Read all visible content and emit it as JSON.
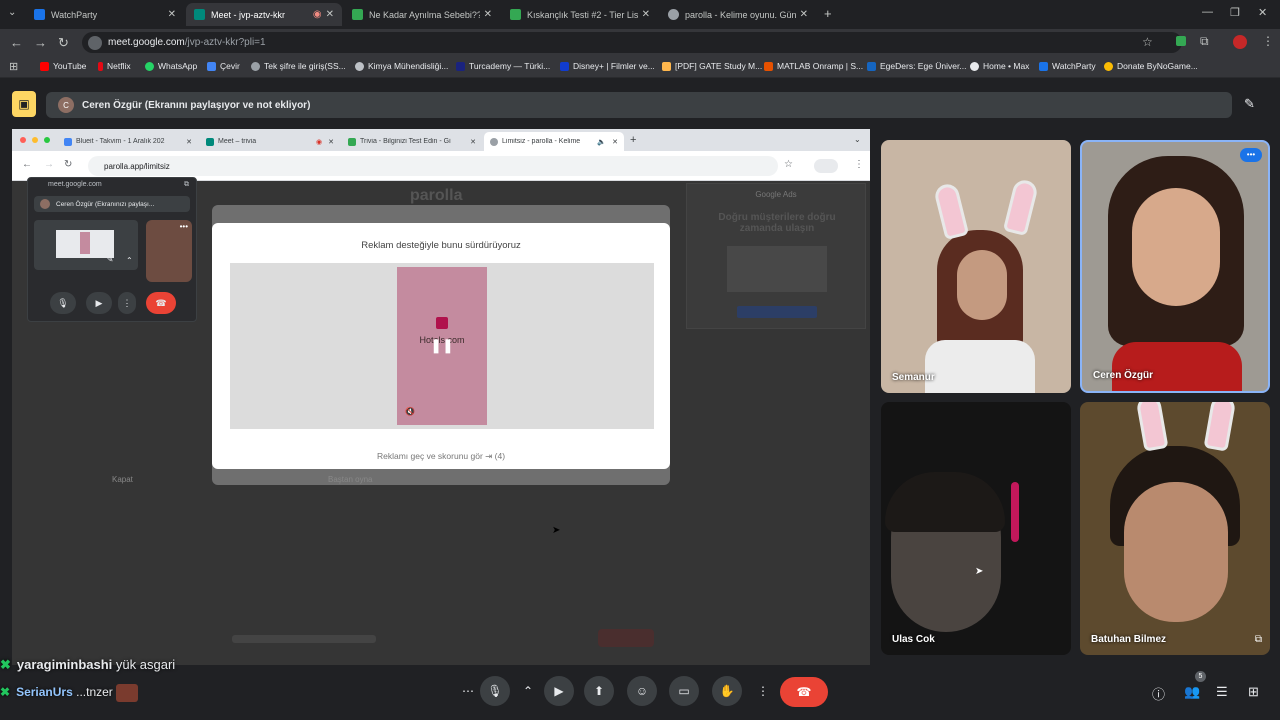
{
  "browser": {
    "tabs": [
      {
        "title": "WatchParty",
        "color": "#1a73e8",
        "active": false
      },
      {
        "title": "Meet - jvp-aztv-kkr",
        "color": "#00897b",
        "active": true
      },
      {
        "title": "Ne Kadar Aynılma Sebebi?? #1",
        "color": "#34a853",
        "active": false
      },
      {
        "title": "Kıskançlık Testi #2 - Tier List, Kı",
        "color": "#34a853",
        "active": false
      },
      {
        "title": "parolla - Kelime oyunu. Günlük",
        "color": "#9aa0a6",
        "active": false
      }
    ],
    "url_host": "meet.google.com",
    "url_path": "/jvp-aztv-kkr?pli=1",
    "bookmarks": [
      "YouTube",
      "Netflix",
      "WhatsApp",
      "Çevir",
      "Tek şifre ile giriş(SS...",
      "Kimya Mühendisliği...",
      "Turcademy — Türki...",
      "Disney+ | Filmler ve...",
      "[PDF] GATE Study M...",
      "MATLAB Onramp | S...",
      "EgeDers: Ege Üniver...",
      "Home • Max",
      "WatchParty",
      "Donate ByNoGame..."
    ]
  },
  "meet": {
    "presenting_text": "Ceren Özgür (Ekranını paylaşıyor ve not ekliyor)",
    "presenter_initial": "C"
  },
  "shared": {
    "tabs": [
      "Blueit - Takvim - 1 Aralık 202",
      "Meet – trivia",
      "Trivia - Bilginizi Test Edin - Gi",
      "Limitsiz - parolla - Kelime"
    ],
    "url": "parolla.app/limitsiz",
    "site_logo": "parolla",
    "side_ad_title": "Google Ads",
    "side_ad_text": "Doğru müşterilere doğru zamanda ulaşın",
    "pip_host": "meet.google.com",
    "pip_bar": "Ceren Özgür (Ekranınızı paylaşı...",
    "dialog_title": "Reklam desteğiyle bunu sürdürüyoruz",
    "ad_brand": "Hotels.com",
    "skip_text": "Reklamı geç ve skorunu gör ⇥ (4)",
    "close_label": "Kapat",
    "play_label": "Baştan oyna"
  },
  "participants": [
    {
      "name": "Semanur"
    },
    {
      "name": "Ceren Özgür"
    },
    {
      "name": "Ulas Cok"
    },
    {
      "name": "Batuhan Bilmez"
    }
  ],
  "controls": {
    "participant_count": "5"
  },
  "chat": [
    {
      "user": "yaragiminbashi",
      "message": "yük asgari"
    },
    {
      "user": "SerianUrs",
      "message": "...tnzer"
    }
  ],
  "colors": {
    "accent": "#8ab4f8",
    "end_call": "#ea4335",
    "present_icon": "#fdd663"
  }
}
